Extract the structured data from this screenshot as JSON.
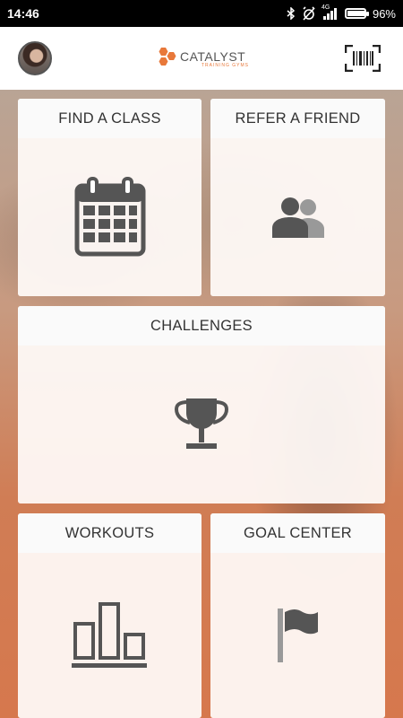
{
  "status_bar": {
    "time": "14:46",
    "network": "4G",
    "battery": "96%",
    "battery_level": 0.96,
    "icons": [
      "bluetooth-icon",
      "alarm-off-icon",
      "signal-icon",
      "battery-icon"
    ]
  },
  "header": {
    "logo_text": "CATALYST",
    "logo_subtext": "TRAINING GYMS",
    "icons": [
      "avatar",
      "catalyst-logo-icon",
      "barcode-scanner-icon"
    ]
  },
  "tiles": {
    "find_class": {
      "label": "FIND A CLASS",
      "icon": "calendar-icon"
    },
    "refer_friend": {
      "label": "REFER A FRIEND",
      "icon": "users-icon"
    },
    "challenges": {
      "label": "CHALLENGES",
      "icon": "trophy-icon"
    },
    "workouts": {
      "label": "WORKOUTS",
      "icon": "bar-chart-icon"
    },
    "goal_center": {
      "label": "GOAL CENTER",
      "icon": "flag-icon"
    }
  },
  "colors": {
    "accent": "#e8783a",
    "icon": "#555555",
    "header_bg": "#ffffff",
    "status_bar_bg": "#000000"
  }
}
